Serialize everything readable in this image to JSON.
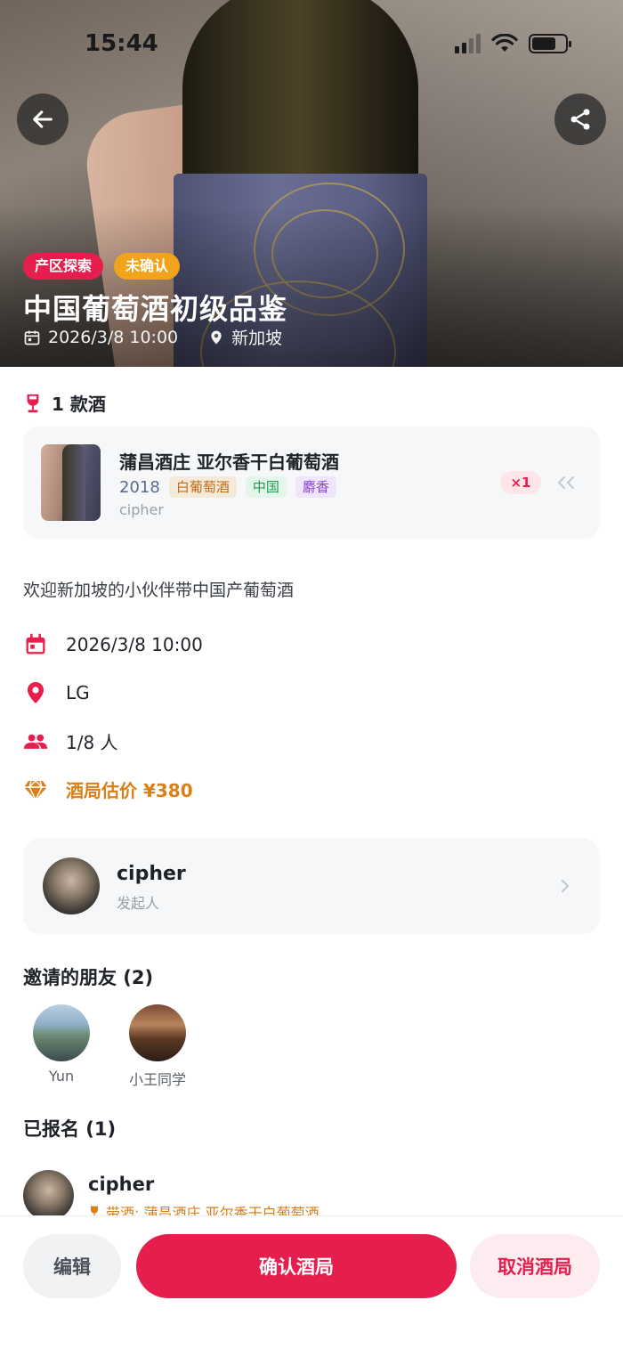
{
  "status_bar": {
    "time": "15:44"
  },
  "hero": {
    "tags": [
      "产区探索",
      "未确认"
    ],
    "title": "中国葡萄酒初级品鉴",
    "datetime": "2026/3/8 10:00",
    "location": "新加坡"
  },
  "wines": {
    "count_label": "1 款酒",
    "items": [
      {
        "name": "蒲昌酒庄 亚尔香干白葡萄酒",
        "vintage": "2018",
        "type": "白葡萄酒",
        "region": "中国",
        "aroma": "麝香",
        "owner": "cipher",
        "quantity": "×1"
      }
    ]
  },
  "description": "欢迎新加坡的小伙伴带中国产葡萄酒",
  "details": {
    "datetime": "2026/3/8 10:00",
    "location": "LG",
    "participants": "1/8 人",
    "price": "酒局估价 ¥380"
  },
  "host": {
    "name": "cipher",
    "role": "发起人"
  },
  "invited": {
    "title": "邀请的朋友 (2)",
    "friends": [
      {
        "name": "Yun"
      },
      {
        "name": "小王同学"
      }
    ]
  },
  "joined": {
    "title": "已报名 (1)",
    "members": [
      {
        "name": "cipher",
        "wine": "带酒: 蒲昌酒庄 亚尔香干白葡萄酒"
      }
    ]
  },
  "actions": {
    "edit": "编辑",
    "confirm": "确认酒局",
    "cancel": "取消酒局"
  },
  "colors": {
    "accent": "#e61e4d",
    "warning": "#f2a31c",
    "price": "#d9801a"
  }
}
